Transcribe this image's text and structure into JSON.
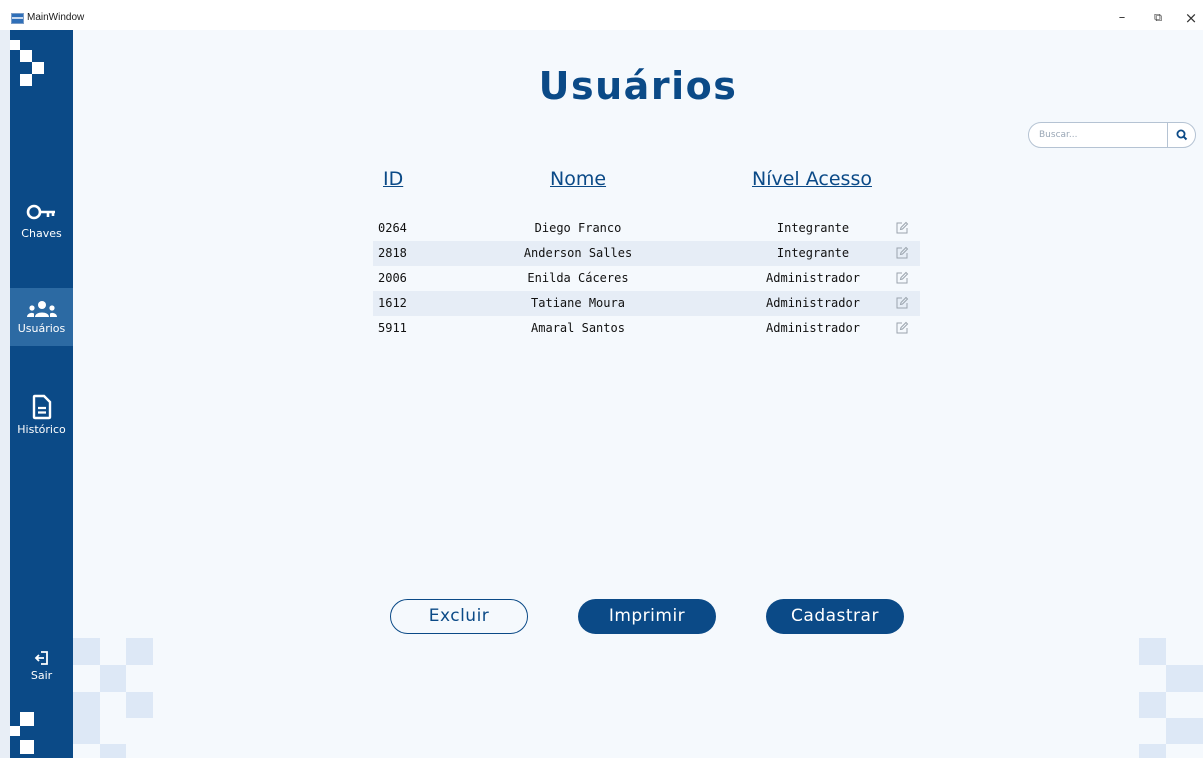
{
  "window": {
    "title": "MainWindow",
    "minimize": "–",
    "restore": "⧉",
    "close": "×"
  },
  "sidebar": {
    "items": [
      {
        "label": "Chaves",
        "icon": "key-icon"
      },
      {
        "label": "Usuários",
        "icon": "users-icon"
      },
      {
        "label": "Histórico",
        "icon": "document-icon"
      }
    ],
    "logout": {
      "label": "Sair",
      "icon": "logout-icon"
    },
    "active_index": 1
  },
  "page": {
    "title": "Usuários"
  },
  "search": {
    "placeholder": "Buscar...",
    "icon": "search-icon"
  },
  "table": {
    "columns": [
      "ID",
      "Nome",
      "Nível Acesso"
    ],
    "rows": [
      {
        "id": "0264",
        "name": "Diego Franco",
        "level": "Integrante"
      },
      {
        "id": "2818",
        "name": "Anderson Salles",
        "level": "Integrante"
      },
      {
        "id": "2006",
        "name": "Enilda Cáceres",
        "level": "Administrador"
      },
      {
        "id": "1612",
        "name": "Tatiane Moura",
        "level": "Administrador"
      },
      {
        "id": "5911",
        "name": "Amaral Santos",
        "level": "Administrador"
      }
    ],
    "row_action_icon": "edit-icon"
  },
  "actions": {
    "delete": "Excluir",
    "print": "Imprimir",
    "register": "Cadastrar"
  },
  "colors": {
    "primary": "#0b4a87",
    "sidebar_active": "#2c6aa3",
    "background": "#f5f9fd",
    "row_alt": "#e6edf6",
    "decoration": "#dde8f6"
  }
}
